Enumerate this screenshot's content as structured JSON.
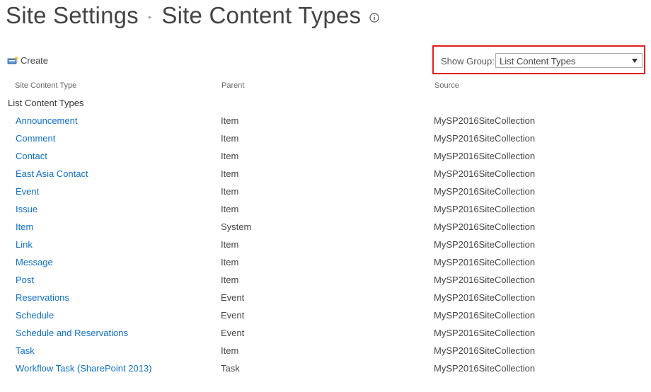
{
  "header": {
    "breadcrumb_parent": "Site Settings",
    "separator": "▸",
    "page_title": "Site Content Types"
  },
  "toolbar": {
    "create_label": "Create",
    "create_icon": "new-content-type-icon"
  },
  "show_group": {
    "label": "Show Group:",
    "selected": "List Content Types",
    "highlight_color": "#e02020"
  },
  "columns": {
    "type": "Site Content Type",
    "parent": "Parent",
    "source": "Source"
  },
  "group_heading": "List Content Types",
  "rows": [
    {
      "name": "Announcement",
      "parent": "Item",
      "source": "MySP2016SiteCollection"
    },
    {
      "name": "Comment",
      "parent": "Item",
      "source": "MySP2016SiteCollection"
    },
    {
      "name": "Contact",
      "parent": "Item",
      "source": "MySP2016SiteCollection"
    },
    {
      "name": "East Asia Contact",
      "parent": "Item",
      "source": "MySP2016SiteCollection"
    },
    {
      "name": "Event",
      "parent": "Item",
      "source": "MySP2016SiteCollection"
    },
    {
      "name": "Issue",
      "parent": "Item",
      "source": "MySP2016SiteCollection"
    },
    {
      "name": "Item",
      "parent": "System",
      "source": "MySP2016SiteCollection"
    },
    {
      "name": "Link",
      "parent": "Item",
      "source": "MySP2016SiteCollection"
    },
    {
      "name": "Message",
      "parent": "Item",
      "source": "MySP2016SiteCollection"
    },
    {
      "name": "Post",
      "parent": "Item",
      "source": "MySP2016SiteCollection"
    },
    {
      "name": "Reservations",
      "parent": "Event",
      "source": "MySP2016SiteCollection"
    },
    {
      "name": "Schedule",
      "parent": "Event",
      "source": "MySP2016SiteCollection"
    },
    {
      "name": "Schedule and Reservations",
      "parent": "Event",
      "source": "MySP2016SiteCollection"
    },
    {
      "name": "Task",
      "parent": "Item",
      "source": "MySP2016SiteCollection"
    },
    {
      "name": "Workflow Task (SharePoint 2013)",
      "parent": "Task",
      "source": "MySP2016SiteCollection"
    }
  ],
  "colors": {
    "link": "#0f6fc6",
    "text": "#444444"
  }
}
